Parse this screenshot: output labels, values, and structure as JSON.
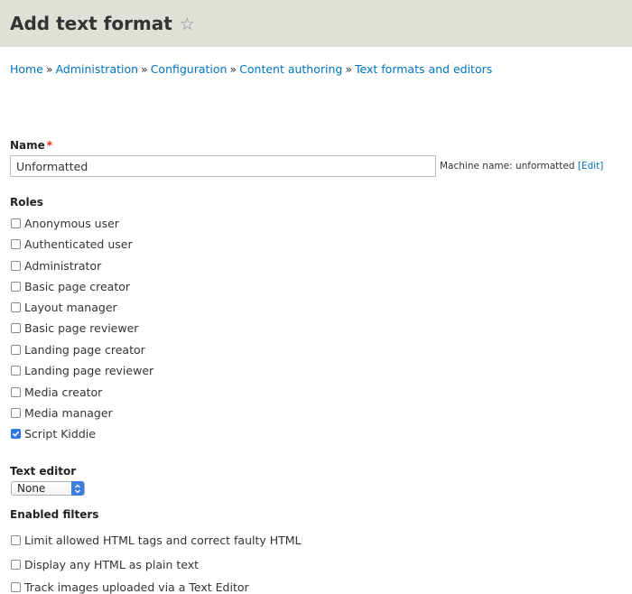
{
  "header": {
    "title": "Add text format"
  },
  "breadcrumb": {
    "items": [
      "Home",
      "Administration",
      "Configuration",
      "Content authoring",
      "Text formats and editors"
    ],
    "separator": "»"
  },
  "name_field": {
    "label": "Name",
    "required_marker": "*",
    "value": "Unformatted",
    "machine_name_prefix": "Machine name: unformatted",
    "edit_link": "[Edit]"
  },
  "roles": {
    "label": "Roles",
    "items": [
      {
        "label": "Anonymous user",
        "checked": false
      },
      {
        "label": "Authenticated user",
        "checked": false
      },
      {
        "label": "Administrator",
        "checked": false
      },
      {
        "label": "Basic page creator",
        "checked": false
      },
      {
        "label": "Layout manager",
        "checked": false
      },
      {
        "label": "Basic page reviewer",
        "checked": false
      },
      {
        "label": "Landing page creator",
        "checked": false
      },
      {
        "label": "Landing page reviewer",
        "checked": false
      },
      {
        "label": "Media creator",
        "checked": false
      },
      {
        "label": "Media manager",
        "checked": false
      },
      {
        "label": "Script Kiddie",
        "checked": true
      }
    ]
  },
  "text_editor": {
    "label": "Text editor",
    "selected": "None"
  },
  "filters": {
    "label": "Enabled filters",
    "items": [
      {
        "label": "Limit allowed HTML tags and correct faulty HTML",
        "checked": false
      },
      {
        "label": "Display any HTML as plain text",
        "checked": false
      },
      {
        "label": "Track images uploaded via a Text Editor",
        "checked": false
      }
    ]
  },
  "colors": {
    "header_bg": "#e0e0d8",
    "link": "#0074bd",
    "required": "#e62600",
    "checkbox_checked": "#2f7ae5"
  }
}
